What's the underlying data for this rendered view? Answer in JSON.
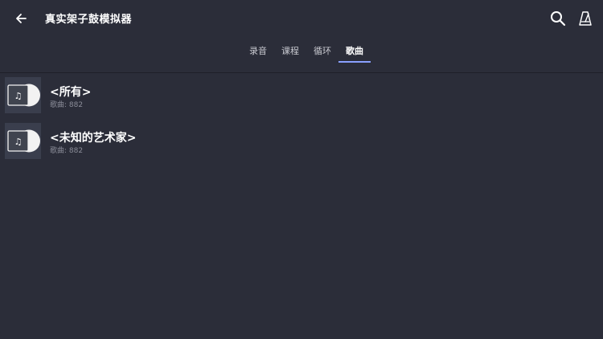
{
  "header": {
    "title": "真实架子鼓模拟器",
    "back_icon": "arrow-left-icon",
    "search_icon": "search-icon",
    "metronome_icon": "metronome-icon"
  },
  "tabs": [
    {
      "label": "录音",
      "active": false
    },
    {
      "label": "课程",
      "active": false
    },
    {
      "label": "循环",
      "active": false
    },
    {
      "label": "歌曲",
      "active": true
    }
  ],
  "list": {
    "items": [
      {
        "title": "<所有>",
        "subtitle": "歌曲: 882",
        "icon": "vinyl-record-icon"
      },
      {
        "title": "<未知的艺术家>",
        "subtitle": "歌曲: 882",
        "icon": "vinyl-record-icon"
      }
    ]
  },
  "colors": {
    "background": "#2b2d39",
    "tab_indicator": "#8aa0ff",
    "subtitle_text": "#8b8d99"
  }
}
